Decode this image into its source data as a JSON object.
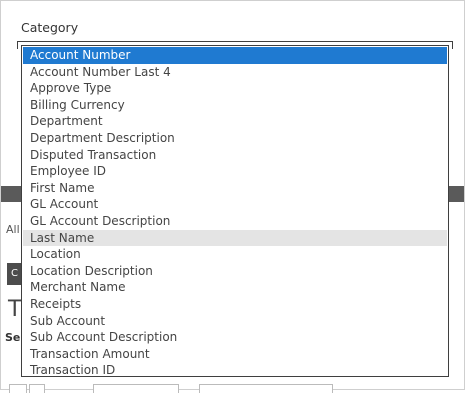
{
  "filter": {
    "label": "Category"
  },
  "background": {
    "all_fragment": "All",
    "button_fragment": "C",
    "heading_fragment": "T",
    "section_fragment": "Se"
  },
  "dropdown": {
    "selected": "Account Number",
    "highlighted": "Last Name",
    "options": [
      "Account Number",
      "Account Number Last 4",
      "Approve Type",
      "Billing Currency",
      "Department",
      "Department Description",
      "Disputed Transaction",
      "Employee ID",
      "First Name",
      "GL Account",
      "GL Account Description",
      "Last Name",
      "Location",
      "Location Description",
      "Merchant Name",
      "Receipts",
      "Sub Account",
      "Sub Account Description",
      "Transaction Amount",
      "Transaction ID"
    ],
    "colors": {
      "selected_bg": "#1f7ad1",
      "hover_bg": "#e4e4e4"
    }
  }
}
